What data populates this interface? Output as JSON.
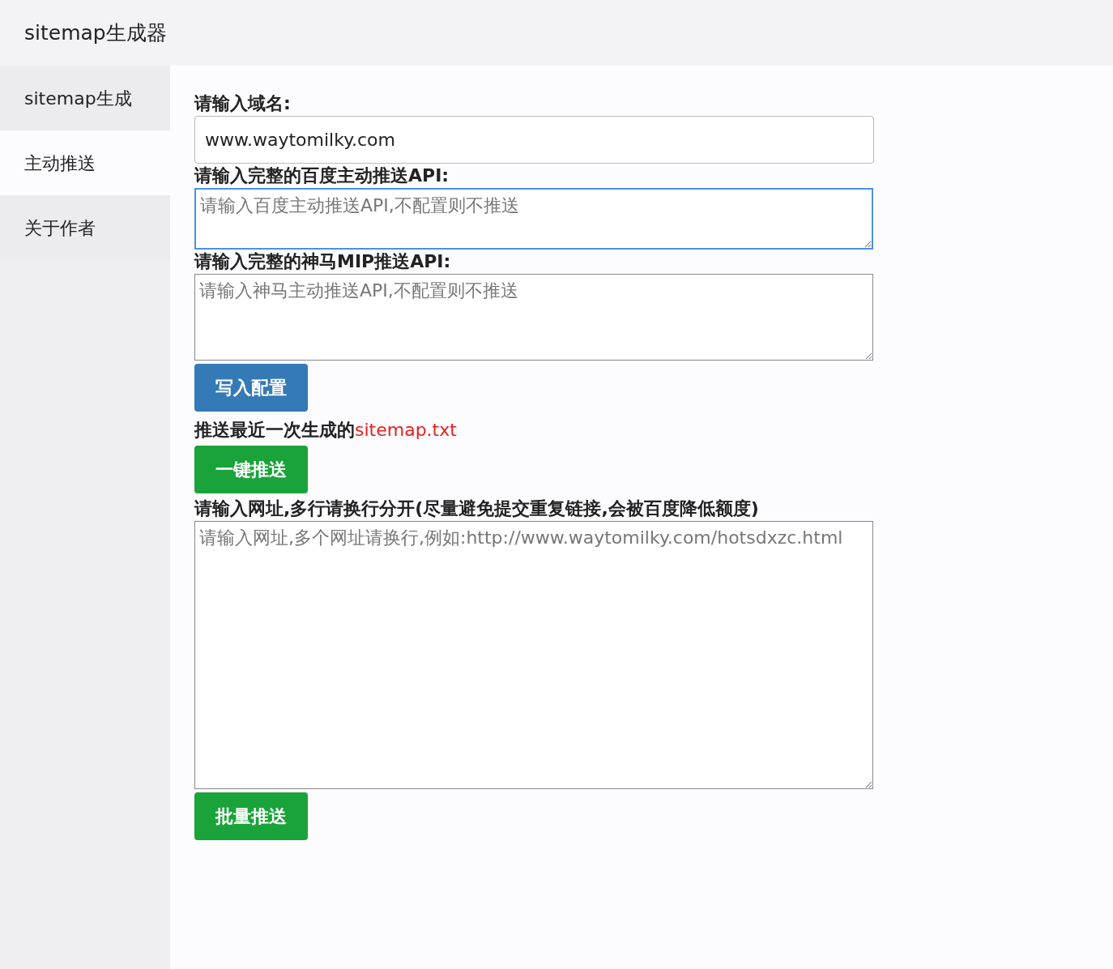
{
  "header": {
    "title": "sitemap生成器"
  },
  "sidebar": {
    "items": [
      {
        "label": "sitemap生成",
        "selected": false
      },
      {
        "label": "主动推送",
        "selected": true
      },
      {
        "label": "关于作者",
        "selected": false
      }
    ]
  },
  "form": [
    {
      "kind": "input",
      "label": "请输入域名:",
      "value": "www.waytomilky.com",
      "focused": false
    },
    {
      "kind": "textarea",
      "label": "请输入完整的百度主动推送API:",
      "placeholder": "请输入百度主动推送API,不配置则不推送",
      "focused": true
    },
    {
      "kind": "textarea",
      "label": "请输入完整的神马MIP推送API:",
      "placeholder": "请输入神马主动推送API,不配置则不推送",
      "focused": false
    },
    {
      "kind": "button",
      "label": "写入配置",
      "color": "#337ab7"
    },
    {
      "kind": "note",
      "text": "推送最近一次生成的",
      "link": "sitemap.txt"
    },
    {
      "kind": "button",
      "label": "一键推送",
      "color": "#1aa33a"
    },
    {
      "kind": "textarea",
      "label": "请输入网址,多行请换行分开(尽量避免提交重复链接,会被百度降低额度)",
      "placeholder": "请输入网址,多个网址请换行,例如:http://www.waytomilky.com/hotsdxzc.html",
      "focused": false
    },
    {
      "kind": "button",
      "label": "批量推送",
      "color": "#1aa33a"
    }
  ]
}
